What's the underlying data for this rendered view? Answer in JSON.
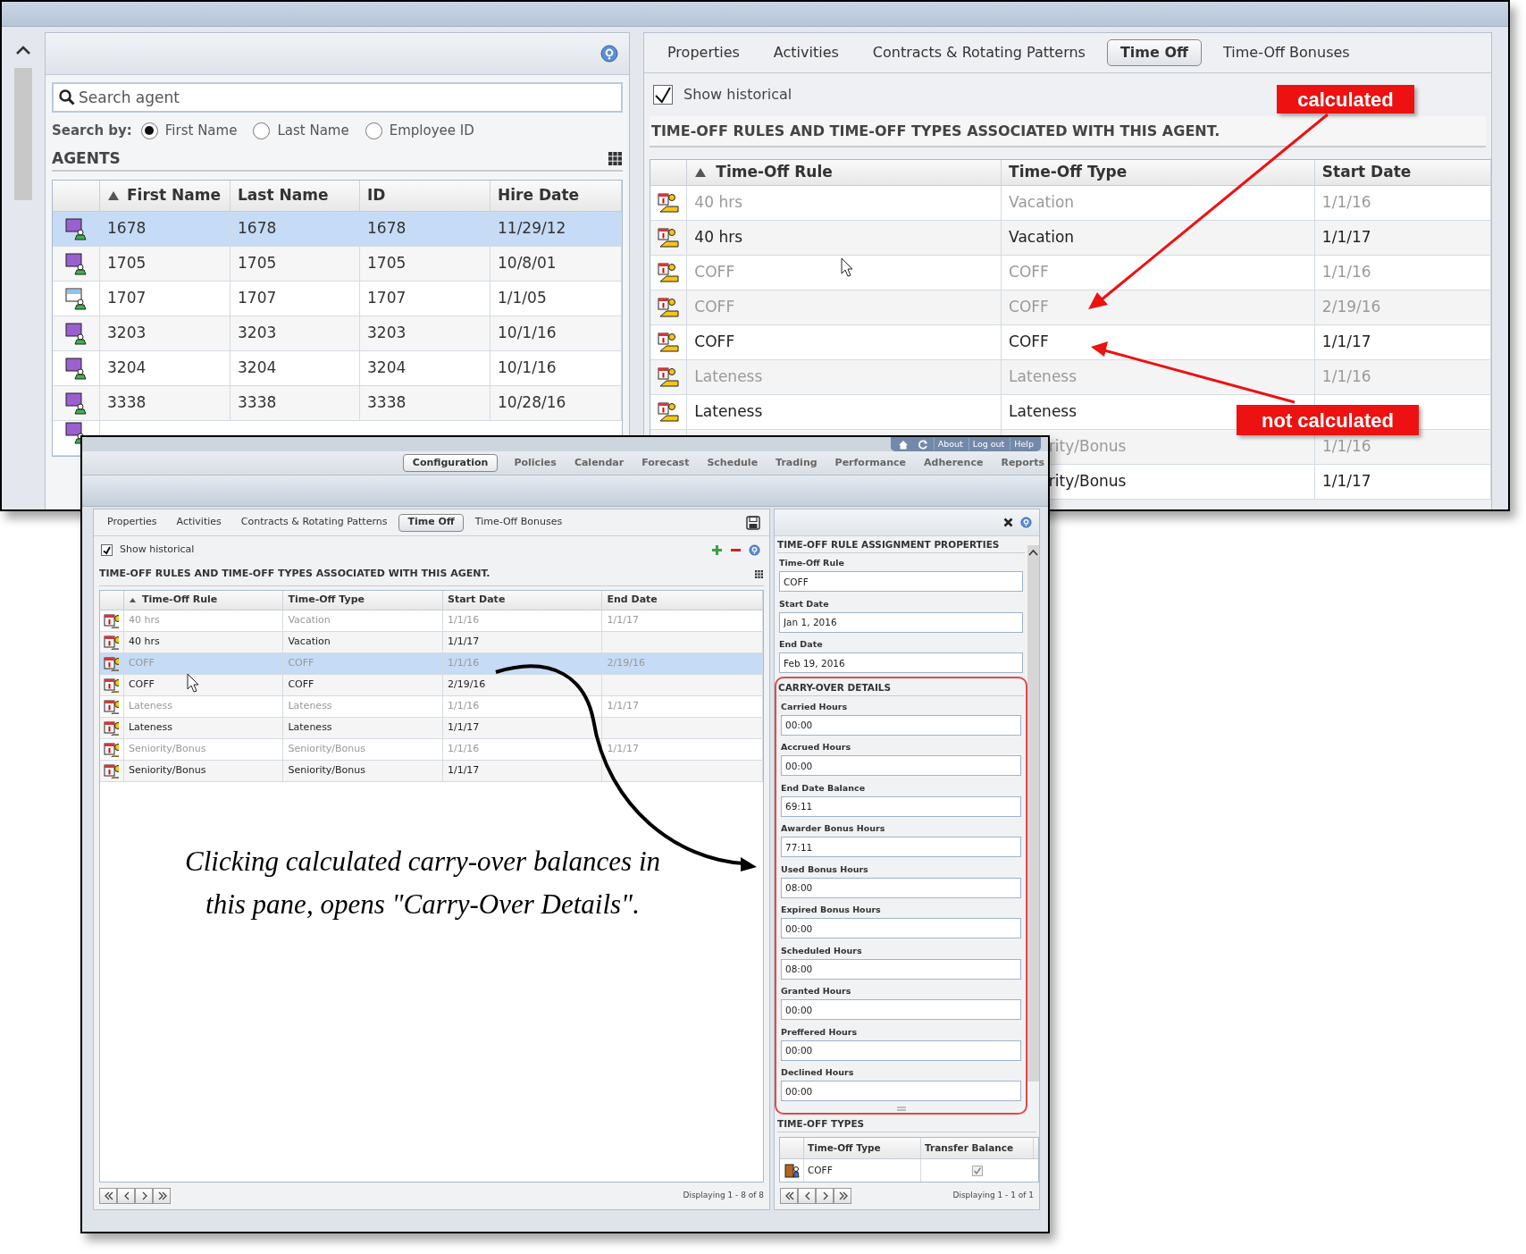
{
  "agents_panel": {
    "search": {
      "placeholder": "Search agent"
    },
    "search_by_label": "Search by:",
    "search_by": [
      {
        "label": "First Name",
        "selected": true
      },
      {
        "label": "Last Name",
        "selected": false
      },
      {
        "label": "Employee ID",
        "selected": false
      }
    ],
    "title": "AGENTS",
    "columns": [
      {
        "label": "First Name",
        "sorted": true
      },
      {
        "label": "Last Name",
        "sorted": false
      },
      {
        "label": "ID",
        "sorted": false
      },
      {
        "label": "Hire Date",
        "sorted": false
      }
    ],
    "rows": [
      {
        "kind": "standard",
        "selected": true,
        "cells": [
          "1678",
          "1678",
          "1678",
          "11/29/12"
        ]
      },
      {
        "kind": "standard",
        "selected": false,
        "cells": [
          "1705",
          "1705",
          "1705",
          "10/8/01"
        ]
      },
      {
        "kind": "alternate",
        "selected": false,
        "cells": [
          "1707",
          "1707",
          "1707",
          "1/1/05"
        ]
      },
      {
        "kind": "standard",
        "selected": false,
        "cells": [
          "3203",
          "3203",
          "3203",
          "10/1/16"
        ]
      },
      {
        "kind": "standard",
        "selected": false,
        "cells": [
          "3204",
          "3204",
          "3204",
          "10/1/16"
        ]
      },
      {
        "kind": "standard",
        "selected": false,
        "cells": [
          "3338",
          "3338",
          "3338",
          "10/28/16"
        ]
      },
      {
        "kind": "standard",
        "selected": false,
        "cells": []
      }
    ]
  },
  "agent_detail": {
    "tabs": [
      {
        "label": "Properties",
        "selected": false
      },
      {
        "label": "Activities",
        "selected": false
      },
      {
        "label": "Contracts & Rotating Patterns",
        "selected": false
      },
      {
        "label": "Time Off",
        "selected": true
      },
      {
        "label": "Time-Off Bonuses",
        "selected": false
      }
    ],
    "show_historical": {
      "label": "Show historical",
      "checked": true
    },
    "heading": "TIME-OFF RULES AND TIME-OFF TYPES ASSOCIATED WITH THIS AGENT.",
    "columns": [
      {
        "label": "Time-Off Rule",
        "sorted": true
      },
      {
        "label": "Time-Off Type",
        "sorted": false
      },
      {
        "label": "Start Date",
        "sorted": false
      }
    ],
    "rows": [
      {
        "historical": true,
        "rule": "40 hrs",
        "type": "Vacation",
        "start": "1/1/16"
      },
      {
        "historical": false,
        "rule": "40 hrs",
        "type": "Vacation",
        "start": "1/1/17"
      },
      {
        "historical": true,
        "rule": "COFF",
        "type": "COFF",
        "start": "1/1/16"
      },
      {
        "historical": true,
        "rule": "COFF",
        "type": "COFF",
        "start": "2/19/16"
      },
      {
        "historical": false,
        "rule": "COFF",
        "type": "COFF",
        "start": "1/1/17"
      },
      {
        "historical": true,
        "rule": "Lateness",
        "type": "Lateness",
        "start": "1/1/16"
      },
      {
        "historical": false,
        "rule": "Lateness",
        "type": "Lateness"
      },
      {
        "historical": true,
        "type": "rity/Bonus",
        "start": "1/1/16"
      },
      {
        "historical": false,
        "type": "rity/Bonus",
        "start": "1/1/17"
      }
    ]
  },
  "callouts": [
    {
      "text": "calculated"
    },
    {
      "text": "not calculated"
    }
  ],
  "app": {
    "top_links": [
      "About",
      "Log out",
      "Help"
    ],
    "nav": [
      {
        "label": "Configuration",
        "selected": true
      },
      {
        "label": "Policies",
        "selected": false
      },
      {
        "label": "Calendar",
        "selected": false
      },
      {
        "label": "Forecast",
        "selected": false
      },
      {
        "label": "Schedule",
        "selected": false
      },
      {
        "label": "Trading",
        "selected": false
      },
      {
        "label": "Performance",
        "selected": false
      },
      {
        "label": "Adherence",
        "selected": false
      },
      {
        "label": "Reports",
        "selected": false
      }
    ],
    "left_panel": {
      "tabs": [
        {
          "label": "Properties",
          "selected": false
        },
        {
          "label": "Activities",
          "selected": false
        },
        {
          "label": "Contracts & Rotating Patterns",
          "selected": false
        },
        {
          "label": "Time Off",
          "selected": true
        },
        {
          "label": "Time-Off Bonuses",
          "selected": false
        }
      ],
      "show_historical": {
        "label": "Show historical",
        "checked": true
      },
      "heading": "TIME-OFF RULES AND TIME-OFF TYPES ASSOCIATED WITH THIS AGENT.",
      "columns": [
        {
          "label": "Time-Off Rule",
          "sorted": true
        },
        {
          "label": "Time-Off Type",
          "sorted": false
        },
        {
          "label": "Start Date",
          "sorted": false
        },
        {
          "label": "End Date",
          "sorted": false
        }
      ],
      "rows": [
        {
          "historical": true,
          "selected": false,
          "rule": "40 hrs",
          "type": "Vacation",
          "start": "1/1/16",
          "end": "1/1/17"
        },
        {
          "historical": false,
          "selected": false,
          "rule": "40 hrs",
          "type": "Vacation",
          "start": "1/1/17"
        },
        {
          "historical": true,
          "selected": true,
          "rule": "COFF",
          "type": "COFF",
          "start": "1/1/16",
          "end": "2/19/16"
        },
        {
          "historical": false,
          "selected": false,
          "rule": "COFF",
          "type": "COFF",
          "start": "2/19/16"
        },
        {
          "historical": true,
          "selected": false,
          "rule": "Lateness",
          "type": "Lateness",
          "start": "1/1/16",
          "end": "1/1/17"
        },
        {
          "historical": false,
          "selected": false,
          "rule": "Lateness",
          "type": "Lateness",
          "start": "1/1/17"
        },
        {
          "historical": true,
          "selected": false,
          "rule": "Seniority/Bonus",
          "type": "Seniority/Bonus",
          "start": "1/1/16",
          "end": "1/1/17"
        },
        {
          "historical": false,
          "selected": false,
          "rule": "Seniority/Bonus",
          "type": "Seniority/Bonus",
          "start": "1/1/17"
        }
      ],
      "annotation": [
        "Clicking calculated carry-over balances in",
        "this pane, opens \"Carry-Over Details\"."
      ],
      "pager_status": "Displaying 1 - 8 of 8"
    },
    "properties_panel": {
      "heading": "TIME-OFF RULE ASSIGNMENT PROPERTIES",
      "fields": [
        {
          "label": "Time-Off Rule",
          "value": "COFF"
        },
        {
          "label": "Start Date",
          "value": "Jan 1, 2016"
        },
        {
          "label": "End Date",
          "value": "Feb 19, 2016"
        }
      ],
      "carry_over": {
        "heading": "CARRY-OVER DETAILS",
        "fields": [
          {
            "label": "Carried Hours",
            "value": "00:00"
          },
          {
            "label": "Accrued Hours",
            "value": "00:00"
          },
          {
            "label": "End Date Balance",
            "value": "69:11"
          },
          {
            "label": "Awarder Bonus Hours",
            "value": "77:11"
          },
          {
            "label": "Used Bonus Hours",
            "value": "08:00"
          },
          {
            "label": "Expired Bonus Hours",
            "value": "00:00"
          },
          {
            "label": "Scheduled Hours",
            "value": "08:00"
          },
          {
            "label": "Granted Hours",
            "value": "00:00"
          },
          {
            "label": "Preffered Hours",
            "value": "00:00"
          },
          {
            "label": "Declined Hours",
            "value": "00:00"
          }
        ]
      },
      "types": {
        "heading": "TIME-OFF TYPES",
        "columns": [
          {
            "label": "Time-Off Type",
            "sorted": false
          },
          {
            "label": "Transfer Balance",
            "sorted": false
          }
        ],
        "rows": [
          {
            "type": "COFF",
            "transfer_balance": true
          }
        ],
        "pager_status": "Displaying 1 - 1 of 1"
      }
    }
  }
}
